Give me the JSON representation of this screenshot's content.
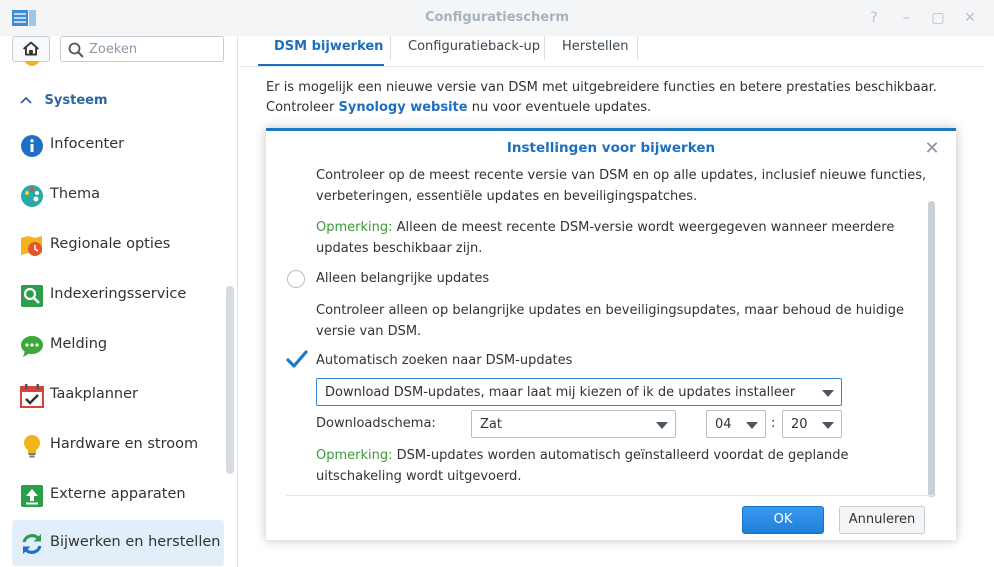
{
  "window": {
    "title": "Configuratiescherm"
  },
  "sidebar": {
    "search": {
      "placeholder": "Zoeken",
      "value": ""
    },
    "section_title": "Systeem",
    "items": [
      {
        "label": "Infocenter"
      },
      {
        "label": "Thema"
      },
      {
        "label": "Regionale opties"
      },
      {
        "label": "Indexeringsservice"
      },
      {
        "label": "Melding"
      },
      {
        "label": "Taakplanner"
      },
      {
        "label": "Hardware en stroom"
      },
      {
        "label": "Externe apparaten"
      },
      {
        "label": "Bijwerken en herstellen"
      }
    ]
  },
  "tabs": [
    {
      "label": "DSM bijwerken"
    },
    {
      "label": "Configuratieback-up"
    },
    {
      "label": "Herstellen"
    }
  ],
  "info": {
    "text_before": "Er is mogelijk een nieuwe versie van DSM met uitgebreidere functies en betere prestaties beschikbaar. Controleer",
    "link": "Synology website",
    "text_after": "nu voor eventuele updates."
  },
  "dialog": {
    "title": "Instellingen voor bijwerken",
    "intro": "Controleer op de meest recente versie van DSM en op alle updates, inclusief nieuwe functies, verbeteringen, essentiële updates en beveiligingspatches.",
    "note1_label": "Opmerking:",
    "note1_text": "Alleen de meest recente DSM-versie wordt weergegeven wanneer meerdere updates beschikbaar zijn.",
    "radio_label": "Alleen belangrijke updates",
    "radio_desc": "Controleer alleen op belangrijke updates en beveiligingsupdates, maar behoud de huidige versie van DSM.",
    "checkbox_label": "Automatisch zoeken naar DSM-updates",
    "mode_select": "Download DSM-updates, maar laat mij kiezen of ik de updates installeer",
    "schedule_label": "Downloadschema:",
    "day_select": "Zat",
    "hour_select": "04",
    "time_sep": ":",
    "minute_select": "20",
    "note2_label": "Opmerking:",
    "note2_text": "DSM-updates worden automatisch geïnstalleerd voordat de geplande uitschakeling wordt uitgevoerd.",
    "ok_label": "OK",
    "cancel_label": "Annuleren"
  },
  "colors": {
    "accent": "#1d6fbf",
    "note": "#3a9a3a",
    "active_item_bg": "#e2eefa"
  }
}
